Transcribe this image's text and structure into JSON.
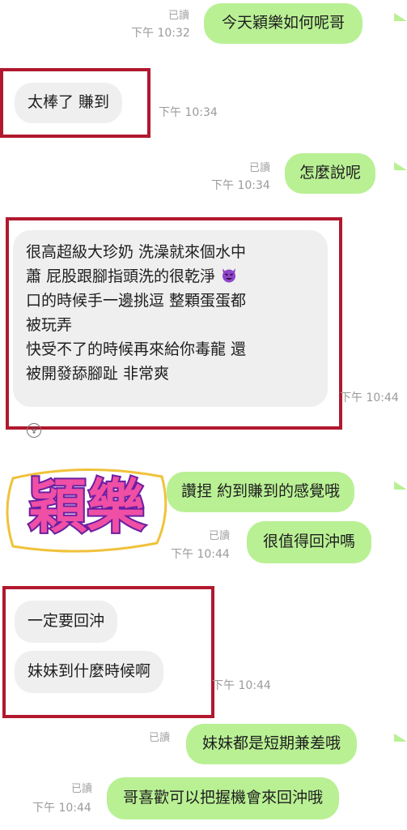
{
  "messages": {
    "m1": {
      "text": "今天穎樂如何呢哥",
      "read": "已讀",
      "time": "下午 10:32"
    },
    "m2": {
      "text": "太棒了 賺到",
      "time": "下午 10:34"
    },
    "m3": {
      "text": "怎麼說呢",
      "read": "已讀",
      "time": "下午 10:34"
    },
    "m4": {
      "lines": [
        "很高超級大珍奶 洗澡就來個水中",
        "蕭 屁股跟腳指頭洗的很乾淨",
        "口的時候手一邊挑逗 整顆蛋蛋都",
        "被玩弄",
        "快受不了的時候再來給你毒龍 還",
        "被開發舔腳趾 非常爽"
      ],
      "time": "下午 10:44"
    },
    "m5": {
      "text": "讚捏 約到賺到的感覺哦"
    },
    "m6": {
      "text": "很值得回沖嗎",
      "read": "已讀",
      "time": "下午 10:44"
    },
    "m7": {
      "text": "一定要回沖"
    },
    "m8": {
      "text": "妹妹到什麼時候啊",
      "time": "下午 10:44"
    },
    "m9": {
      "text": "妹妹都是短期兼差哦",
      "read": "已讀"
    },
    "m10": {
      "text": "哥喜歡可以把握機會來回沖哦",
      "read": "已讀",
      "time": "下午 10:44"
    }
  },
  "sticker": {
    "text": "穎樂"
  },
  "icons": {
    "devil": "smiling-devil-emoji",
    "reaction": "reaction-icon"
  },
  "colors": {
    "outgoing": "#b9f094",
    "incoming": "#efefef",
    "highlight": "#b1182e"
  }
}
